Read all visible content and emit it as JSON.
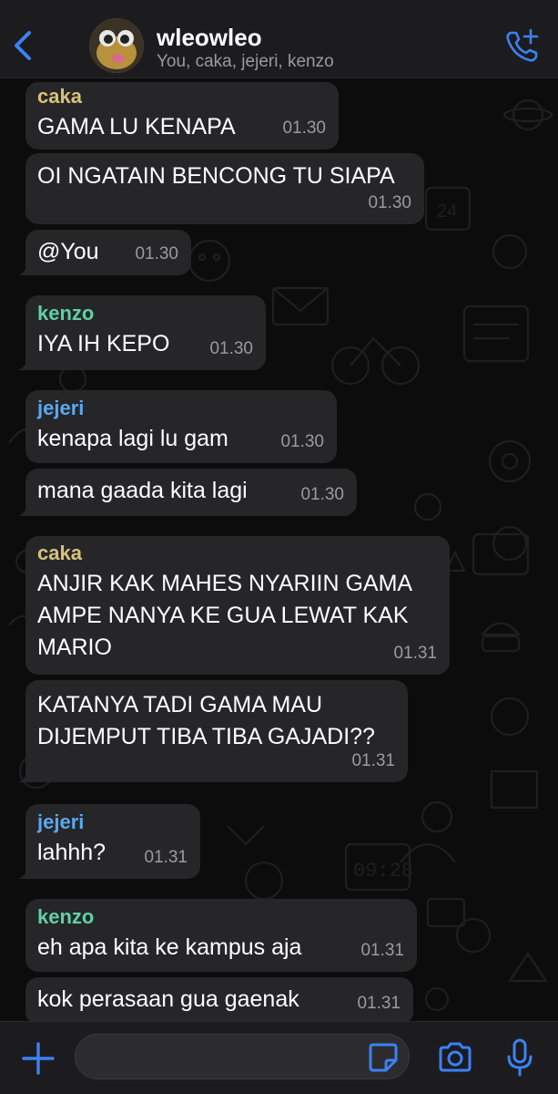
{
  "colors": {
    "accent": "#3b82f6",
    "bubble_bg": "#262628",
    "time_text": "#9b9b9f",
    "sender_caka": "#d8c27a",
    "sender_kenzo": "#5fd1a5",
    "sender_jejeri": "#5aa8f0"
  },
  "header": {
    "group_name": "wleowleo",
    "members": "You, caka, jejeri, kenzo",
    "back_icon": "chevron-left-icon",
    "call_icon": "add-call-icon"
  },
  "messages": [
    {
      "sender": "caka",
      "text": "GAMA LU KENAPA",
      "time": "01.30"
    },
    {
      "sender": "",
      "text": "OI NGATAIN BENCONG TU SIAPA",
      "time": "01.30"
    },
    {
      "sender": "",
      "text": "@You",
      "time": "01.30"
    },
    {
      "sender": "kenzo",
      "text": "IYA IH KEPO",
      "time": "01.30"
    },
    {
      "sender": "jejeri",
      "text": "kenapa lagi lu gam",
      "time": "01.30"
    },
    {
      "sender": "",
      "text": "mana gaada kita lagi",
      "time": "01.30"
    },
    {
      "sender": "caka",
      "text": "ANJIR KAK MAHES NYARIIN GAMA AMPE NANYA KE GUA LEWAT KAK MARIO",
      "time": "01.31"
    },
    {
      "sender": "",
      "text": "KATANYA TADI GAMA MAU DIJEMPUT TIBA TIBA GAJADI??",
      "time": "01.31"
    },
    {
      "sender": "jejeri",
      "text": "lahhh?",
      "time": "01.31"
    },
    {
      "sender": "kenzo",
      "text": "eh apa kita ke kampus aja",
      "time": "01.31"
    },
    {
      "sender": "",
      "text": "kok perasaan gua gaenak",
      "time": "01.31"
    }
  ],
  "input_bar": {
    "message_value": "",
    "plus_icon": "plus-icon",
    "sticker_icon": "sticker-icon",
    "camera_icon": "camera-icon",
    "mic_icon": "microphone-icon"
  }
}
